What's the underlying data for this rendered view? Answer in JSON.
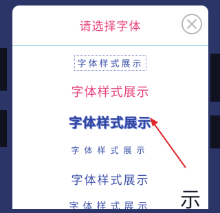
{
  "dialog": {
    "title": "请选择字体",
    "close_icon": "close-circle-icon"
  },
  "font_options": [
    {
      "label": "字体样式展示"
    },
    {
      "label": "字体样式展示"
    },
    {
      "label": "字体样式展示"
    },
    {
      "label": "字体样式展示"
    },
    {
      "label": "字体样式展示"
    },
    {
      "label": "字体样式展示"
    }
  ],
  "background": {
    "partial_text": "示"
  },
  "colors": {
    "accent_pink": "#e8417d",
    "font_blue": "#3b4fa8",
    "divider": "#8cd3df",
    "arrow_red": "#e0262b",
    "backdrop": "#2b3568"
  }
}
